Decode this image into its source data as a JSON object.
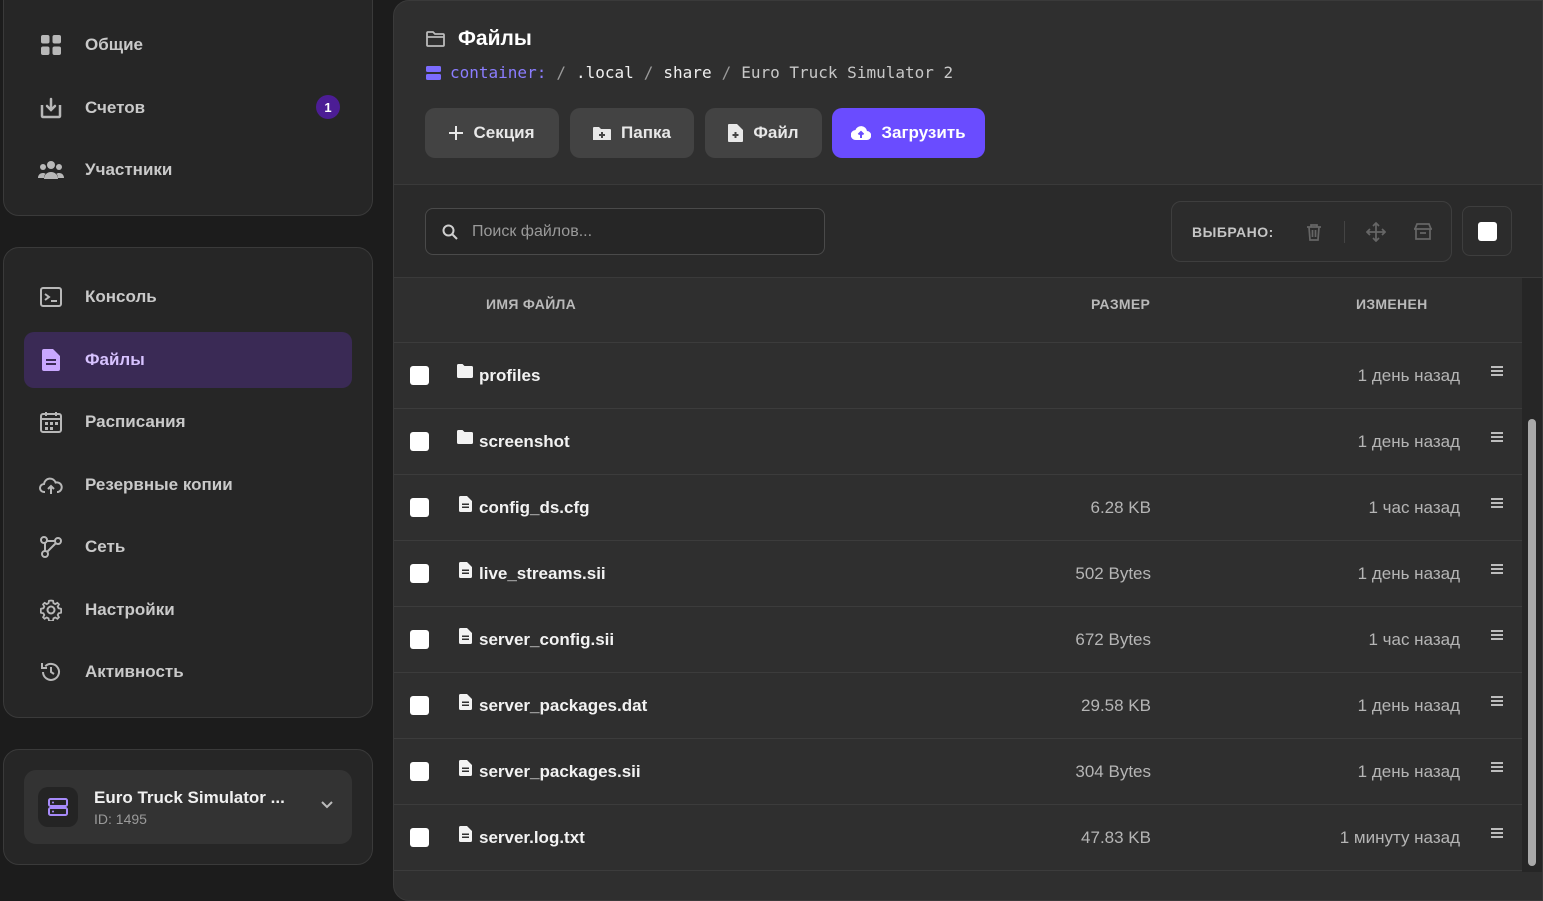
{
  "sidebar": {
    "top_items": [
      {
        "label": "Общие",
        "icon": "grid-icon"
      },
      {
        "label": "Счетов",
        "icon": "download-box-icon",
        "badge": "1"
      },
      {
        "label": "Участники",
        "icon": "users-icon"
      }
    ],
    "main_items": [
      {
        "label": "Консоль",
        "icon": "terminal-icon"
      },
      {
        "label": "Файлы",
        "icon": "file-icon",
        "active": true
      },
      {
        "label": "Расписания",
        "icon": "calendar-icon"
      },
      {
        "label": "Резервные копии",
        "icon": "cloud-backup-icon"
      },
      {
        "label": "Сеть",
        "icon": "network-icon"
      },
      {
        "label": "Настройки",
        "icon": "gear-icon"
      },
      {
        "label": "Активность",
        "icon": "history-icon"
      }
    ],
    "server": {
      "name": "Euro Truck Simulator ...",
      "id": "ID: 1495",
      "icon": "server-icon"
    }
  },
  "header": {
    "title": "Файлы",
    "breadcrumb": {
      "root": "container:",
      "separator": "/",
      "parts": [
        ".local",
        "share",
        "Euro Truck Simulator 2"
      ]
    }
  },
  "actions": {
    "section": "Секция",
    "folder": "Папка",
    "file": "Файл",
    "upload": "Загрузить"
  },
  "toolbar": {
    "search_placeholder": "Поиск файлов...",
    "selected_label": "ВЫБРАНО:"
  },
  "table": {
    "columns": {
      "name": "ИМЯ ФАЙЛА",
      "size": "РАЗМЕР",
      "modified": "ИЗМЕНЕН"
    },
    "rows": [
      {
        "type": "folder",
        "name": "profiles",
        "size": "",
        "modified": "1 день назад"
      },
      {
        "type": "folder",
        "name": "screenshot",
        "size": "",
        "modified": "1 день назад"
      },
      {
        "type": "file",
        "name": "config_ds.cfg",
        "size": "6.28 KB",
        "modified": "1 час назад"
      },
      {
        "type": "file",
        "name": "live_streams.sii",
        "size": "502 Bytes",
        "modified": "1 день назад"
      },
      {
        "type": "file",
        "name": "server_config.sii",
        "size": "672 Bytes",
        "modified": "1 час назад"
      },
      {
        "type": "file",
        "name": "server_packages.dat",
        "size": "29.58 KB",
        "modified": "1 день назад"
      },
      {
        "type": "file",
        "name": "server_packages.sii",
        "size": "304 Bytes",
        "modified": "1 день назад"
      },
      {
        "type": "file",
        "name": "server.log.txt",
        "size": "47.83 KB",
        "modified": "1 минуту назад"
      }
    ]
  },
  "colors": {
    "accent": "#6a4cff",
    "active_nav": "#3a2a55",
    "badge": "#4c1d95",
    "breadcrumb_root": "#8b7dff"
  }
}
